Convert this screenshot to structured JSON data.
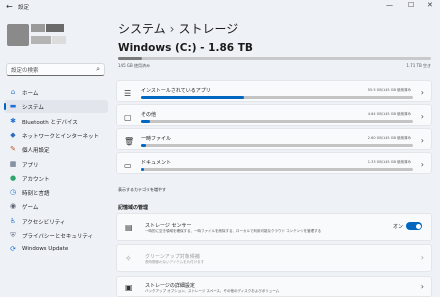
{
  "window": {
    "title": "設定",
    "back": "←",
    "controls": {
      "minimize": "—",
      "maximize": "☐",
      "close": "✕"
    }
  },
  "sidebar": {
    "search_placeholder": "設定の検索",
    "items": [
      {
        "label": "ホーム",
        "icon": "home-icon",
        "glyph": "⌂",
        "color": "#3a7bd5"
      },
      {
        "label": "システム",
        "icon": "monitor-icon",
        "glyph": "▬",
        "color": "#1e6fd9",
        "active": true
      },
      {
        "label": "Bluetooth とデバイス",
        "icon": "bluetooth-icon",
        "glyph": "✱",
        "color": "#1e6fd9"
      },
      {
        "label": "ネットワークとインターネット",
        "icon": "network-icon",
        "glyph": "◆",
        "color": "#2a6cc4"
      },
      {
        "label": "個人用設定",
        "icon": "brush-icon",
        "glyph": "✎",
        "color": "#c0562a"
      },
      {
        "label": "アプリ",
        "icon": "apps-icon",
        "glyph": "▦",
        "color": "#4a5a70"
      },
      {
        "label": "アカウント",
        "icon": "account-icon",
        "glyph": "●",
        "color": "#2ea56a"
      },
      {
        "label": "時刻と言語",
        "icon": "clock-icon",
        "glyph": "◷",
        "color": "#2a7bd0"
      },
      {
        "label": "ゲーム",
        "icon": "gamepad-icon",
        "glyph": "◉",
        "color": "#5a6270"
      },
      {
        "label": "アクセシビリティ",
        "icon": "accessibility-icon",
        "glyph": "♿",
        "color": "#2a7bd0"
      },
      {
        "label": "プライバシーとセキュリティ",
        "icon": "shield-icon",
        "glyph": "⛨",
        "color": "#6c7686"
      },
      {
        "label": "Windows Update",
        "icon": "update-icon",
        "glyph": "⟳",
        "color": "#1e6fd9"
      }
    ]
  },
  "main": {
    "breadcrumb_parent": "システム",
    "breadcrumb_sep": "›",
    "breadcrumb_current": "ストレージ",
    "drive_title": "Windows (C:) - 1.86 TB",
    "used_text": "145 GB 使用済み",
    "free_text": "1.71 TB 空き",
    "used_fraction": 0.078,
    "categories": [
      {
        "label": "インストールされているアプリ",
        "usage": "55.5 GB/145 GB 使用済み",
        "fraction": 0.38,
        "icon": "list-icon",
        "glyph": "☰"
      },
      {
        "label": "その他",
        "usage": "4.64 GB/145 GB 使用済み",
        "fraction": 0.032,
        "icon": "folder-icon",
        "glyph": "▢"
      },
      {
        "label": "一時ファイル",
        "usage": "2.60 GB/145 GB 使用済み",
        "fraction": 0.018,
        "icon": "trash-icon",
        "glyph": "🗑"
      },
      {
        "label": "ドキュメント",
        "usage": "1.33 GB/145 GB 使用済み",
        "fraction": 0.009,
        "icon": "document-icon",
        "glyph": "▭"
      }
    ],
    "more_categories_link": "表示するカテゴリを増やす",
    "section_heading": "記憶域の管理",
    "settings": [
      {
        "title": "ストレージ センサー",
        "desc": "一時的に空き領域を確保する、一時ファイルを削除する、ローカルで利用可能なクラウド コンテンツを管理する",
        "icon": "storage-sense-icon",
        "glyph": "▤",
        "toggle": "オン"
      },
      {
        "title": "クリーンアップ対象候補",
        "desc": "長時間使わないアイテムを片付けます",
        "icon": "broom-icon",
        "glyph": "✧",
        "disabled": true
      },
      {
        "title": "ストレージの詳細設定",
        "desc": "バックアップ オプション、ストレージ スペース、その他のディスクおよびボリューム",
        "icon": "drive-icon",
        "glyph": "▣"
      }
    ]
  }
}
